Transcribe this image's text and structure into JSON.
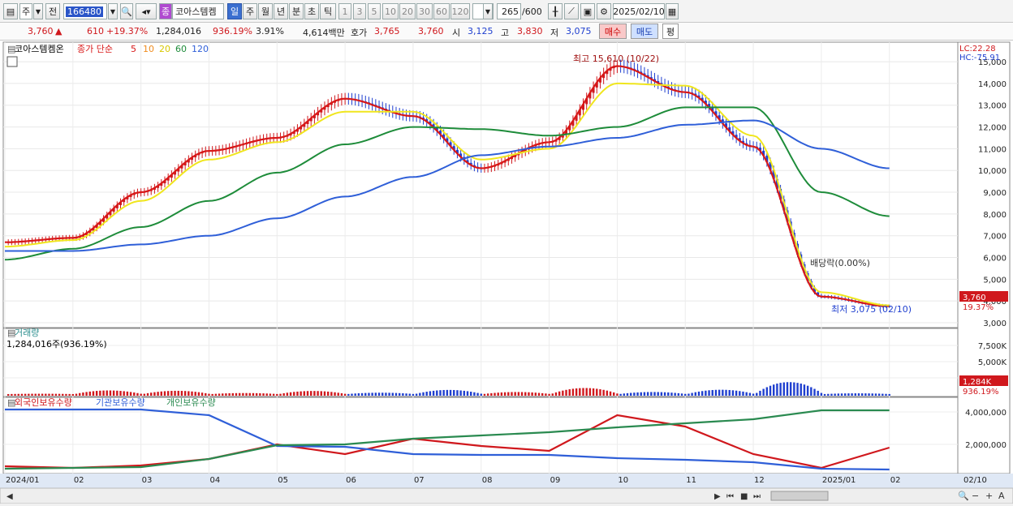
{
  "toolbar": {
    "market_type": "주",
    "prefix": "전",
    "code": "166480",
    "stock_name": "코아스템켐",
    "name_badge": "종",
    "periods": [
      "일",
      "주",
      "월",
      "년",
      "분",
      "초",
      "틱"
    ],
    "active_period": "일",
    "intervals": [
      "1",
      "3",
      "5",
      "10",
      "20",
      "30",
      "60",
      "120"
    ],
    "count": "265",
    "count_total": "/600",
    "date": "2025/02/10"
  },
  "quote": {
    "price": "3,760",
    "price_arrow": "▲",
    "change": "610",
    "change_pct": "+19.37%",
    "volume": "1,284,016",
    "volume_ratio": "936.19%",
    "turnover": "3.91%",
    "amount": "4,614백만",
    "ask_label": "호가",
    "ask1": "3,765",
    "ask2": "3,760",
    "open_label": "시",
    "open": "3,125",
    "high_label": "고",
    "high": "3,830",
    "low_label": "저",
    "low": "3,075",
    "buy_label": "매수",
    "sell_label": "매도",
    "eval_label": "평"
  },
  "colors": {
    "red": "#d0181d",
    "blue": "#1f3fcf",
    "ma5": "#d81818",
    "ma10": "#f08c1e",
    "ma20": "#f0e61e",
    "ma60": "#1e8c3a",
    "ma120": "#2f5fd8"
  },
  "price_panel": {
    "legend_name": "코아스템켐온",
    "legend_type": "종가 단순",
    "ma_labels": [
      "5",
      "10",
      "20",
      "60",
      "120"
    ],
    "lc": "LC:22.28",
    "hc": "HC:-75.91",
    "y_ticks": [
      "15,000",
      "14,000",
      "13,000",
      "12,000",
      "11,000",
      "10,000",
      "9,000",
      "8,000",
      "7,000",
      "6,000",
      "5,000",
      "4,000",
      "3,000"
    ],
    "current_price_tag": "3,760",
    "current_pct_tag": "19.37%",
    "high_label": "최고 15,610 (10/22)",
    "low_label": "최저 3,075 (02/10)",
    "dividend_label": "배당락(0.00%)"
  },
  "volume_panel": {
    "title": "거래량",
    "value": "1,284,016주(936.19%)",
    "y_ticks": [
      "7,500K",
      "5,000K",
      "2,500K"
    ],
    "tag": "1,284K",
    "tag_pct": "936.19%"
  },
  "holdings_panel": {
    "legends": [
      "외국인보유수량",
      "기관보유수량",
      "개인보유수량"
    ],
    "y_ticks": [
      "4,000,000",
      "2,000,000"
    ]
  },
  "x_axis": {
    "labels": [
      "2024/01",
      "02",
      "03",
      "04",
      "05",
      "06",
      "07",
      "08",
      "09",
      "10",
      "11",
      "12",
      "2025/01",
      "02"
    ],
    "right_label": "02/10"
  },
  "chart_data": {
    "type": "line",
    "title": "",
    "x": [
      "2024/01",
      "02",
      "03",
      "04",
      "05",
      "06",
      "07",
      "08",
      "09",
      "10",
      "11",
      "12",
      "2025/01",
      "02"
    ],
    "ylim": [
      3000,
      15600
    ],
    "series": [
      {
        "name": "종가 단순 5",
        "values": [
          6700,
          6900,
          9000,
          10900,
          11500,
          13300,
          12500,
          10100,
          11300,
          14800,
          13600,
          11100,
          4200,
          3760
        ]
      },
      {
        "name": "20",
        "values": [
          6500,
          6800,
          8600,
          10500,
          11300,
          12700,
          12700,
          10500,
          11000,
          14000,
          13900,
          11600,
          4400,
          3800
        ]
      },
      {
        "name": "60",
        "values": [
          5900,
          6400,
          7400,
          8600,
          9900,
          11200,
          12000,
          11900,
          11600,
          12000,
          12900,
          12900,
          9000,
          7900
        ]
      },
      {
        "name": "120",
        "values": [
          6300,
          6300,
          6600,
          7000,
          7800,
          8800,
          9700,
          10700,
          11100,
          11500,
          12100,
          12300,
          11000,
          10100
        ]
      }
    ]
  }
}
